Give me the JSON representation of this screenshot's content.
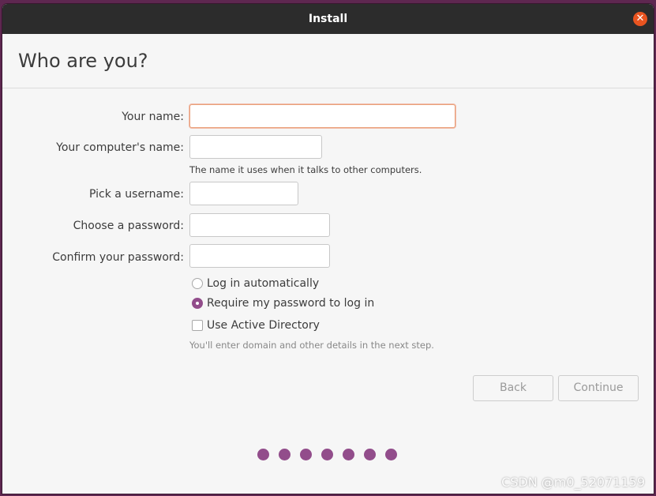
{
  "window": {
    "title": "Install"
  },
  "page": {
    "heading": "Who are you?"
  },
  "form": {
    "name_label": "Your name:",
    "name_value": "",
    "computer_label": "Your computer's name:",
    "computer_value": "",
    "computer_hint": "The name it uses when it talks to other computers.",
    "username_label": "Pick a username:",
    "username_value": "",
    "password_label": "Choose a password:",
    "confirm_label": "Confirm your password:"
  },
  "login_options": {
    "auto_label": "Log in automatically",
    "require_label": "Require my password to log in",
    "selected": "Require my password to log in"
  },
  "active_directory": {
    "label": "Use Active Directory",
    "checked": false,
    "hint": "You'll enter domain and other details in the next step."
  },
  "buttons": {
    "back": "Back",
    "continue": "Continue"
  },
  "progress": {
    "total_steps": 7
  },
  "colors": {
    "accent": "#e95420",
    "aubergine": "#924d8b",
    "titlebar": "#2c2c2c"
  },
  "watermark": "CSDN @m0_52071159"
}
